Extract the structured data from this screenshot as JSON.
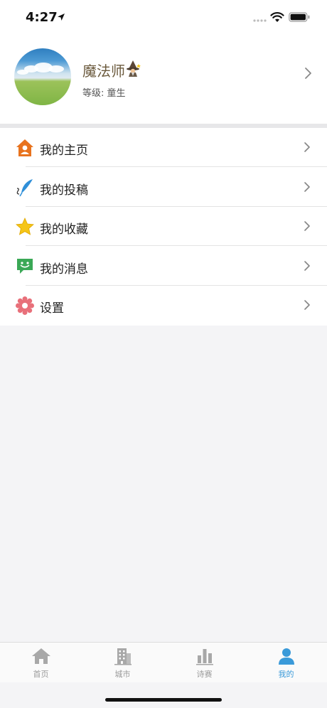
{
  "status_bar": {
    "time": "4:27"
  },
  "profile": {
    "name": "魔法师",
    "level": "等级: 童生"
  },
  "menu": [
    {
      "label": "我的主页",
      "icon": "home-icon"
    },
    {
      "label": "我的投稿",
      "icon": "quill-icon"
    },
    {
      "label": "我的收藏",
      "icon": "star-icon"
    },
    {
      "label": "我的消息",
      "icon": "message-icon"
    },
    {
      "label": "设置",
      "icon": "gear-icon"
    }
  ],
  "tabbar": [
    {
      "label": "首页",
      "icon": "home-icon"
    },
    {
      "label": "城市",
      "icon": "building-icon"
    },
    {
      "label": "诗赛",
      "icon": "bar-chart-icon"
    },
    {
      "label": "我的",
      "icon": "person-icon",
      "active": true
    }
  ],
  "colors": {
    "accent": "#3a9ad9",
    "home_icon": "#e8731e",
    "star_icon": "#f5c518",
    "message_icon": "#3aa856",
    "gear_icon": "#e8707a",
    "quill_icon": "#2f8fd8"
  }
}
